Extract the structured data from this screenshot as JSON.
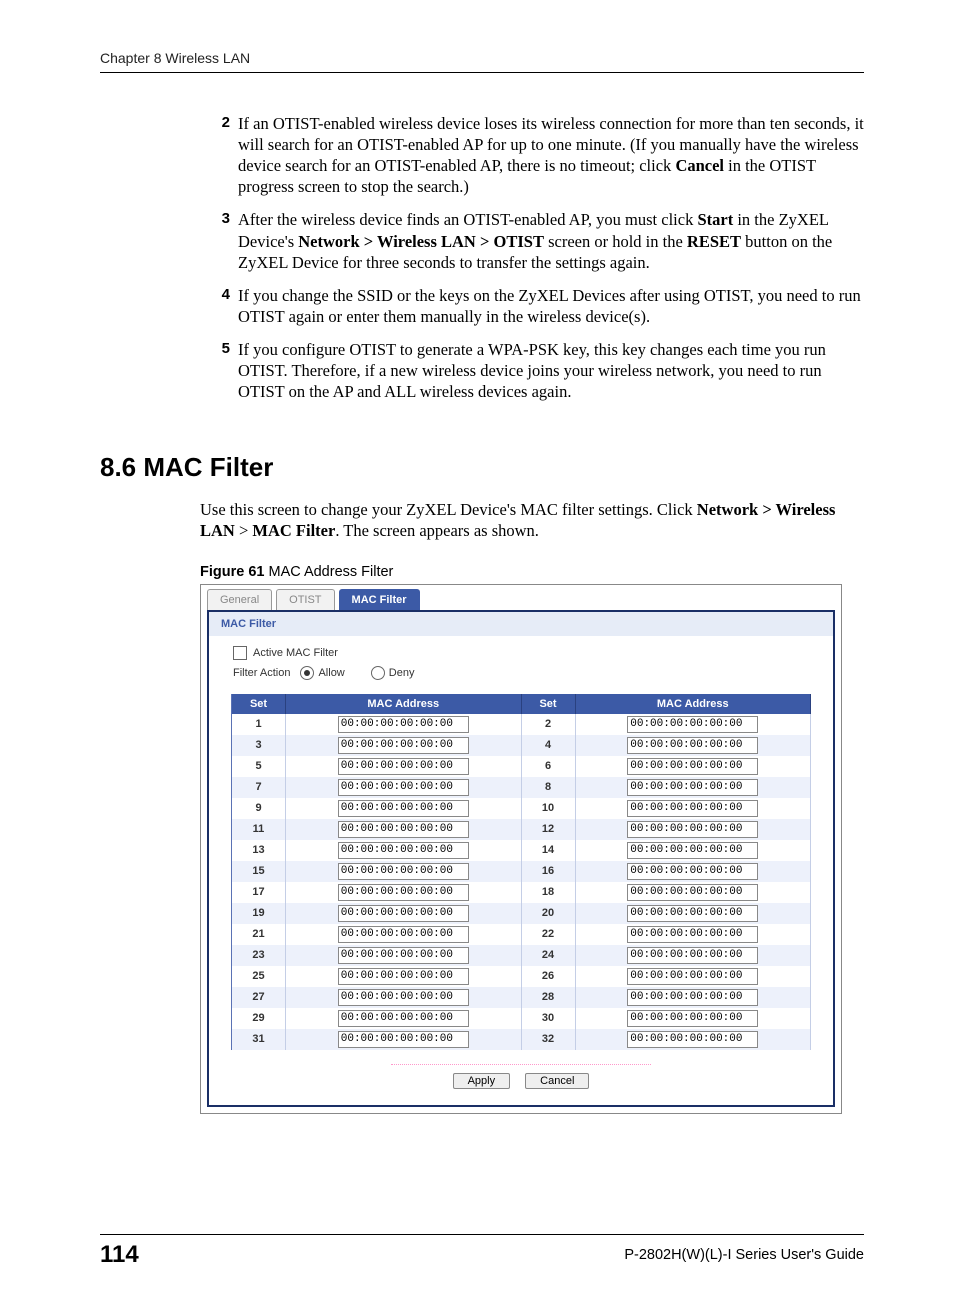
{
  "header": {
    "chapter": "Chapter 8 Wireless LAN"
  },
  "list": {
    "n2": "2",
    "t2a": "If an OTIST-enabled wireless device loses its wireless connection for more than ten seconds, it will search for an OTIST-enabled AP for up to one minute. (If you manually have the wireless device search for an OTIST-enabled AP, there is no timeout; click ",
    "t2b_bold": "Cancel",
    "t2c": " in the OTIST progress screen to stop the search.)",
    "n3": "3",
    "t3a": "After the wireless device finds an OTIST-enabled AP, you must click ",
    "t3b_bold": "Start",
    "t3c": " in the ZyXEL Device's ",
    "t3d_bold": "Network > Wireless LAN > OTIST",
    "t3e": " screen or hold in the ",
    "t3f_bold": "RESET",
    "t3g": " button on the ZyXEL Device for three seconds to transfer the settings again.",
    "n4": "4",
    "t4": "If you change the SSID or the keys on the ZyXEL Devices after using OTIST, you need to run OTIST again or enter them manually in the wireless device(s).",
    "n5": "5",
    "t5": "If you configure OTIST to generate a WPA-PSK key, this key changes each time you run OTIST. Therefore, if a new wireless device joins your wireless network, you need to run OTIST on the AP and ALL wireless devices again."
  },
  "section": {
    "heading": "8.6  MAC Filter",
    "para_a": "Use this screen to change your ZyXEL Device's MAC filter settings. Click ",
    "para_b_bold": "Network > Wireless LAN",
    "para_c": " > ",
    "para_d_bold": "MAC Filter",
    "para_e": ". The screen appears as shown."
  },
  "figure": {
    "label": "Figure 61",
    "title": "   MAC Address Filter"
  },
  "ui": {
    "tabs": {
      "general": "General",
      "otist": "OTIST",
      "mac": "MAC Filter"
    },
    "section_title": "MAC Filter",
    "active_label": "Active MAC Filter",
    "filter_action_label": "Filter Action",
    "allow": "Allow",
    "deny": "Deny",
    "th_set": "Set",
    "th_mac": "MAC Address",
    "default_mac": "00:00:00:00:00:00",
    "rows": [
      1,
      2,
      3,
      4,
      5,
      6,
      7,
      8,
      9,
      10,
      11,
      12,
      13,
      14,
      15,
      16,
      17,
      18,
      19,
      20,
      21,
      22,
      23,
      24,
      25,
      26,
      27,
      28,
      29,
      30,
      31,
      32
    ],
    "apply": "Apply",
    "cancel": "Cancel"
  },
  "footer": {
    "page": "114",
    "guide": "P-2802H(W)(L)-I Series User's Guide"
  }
}
